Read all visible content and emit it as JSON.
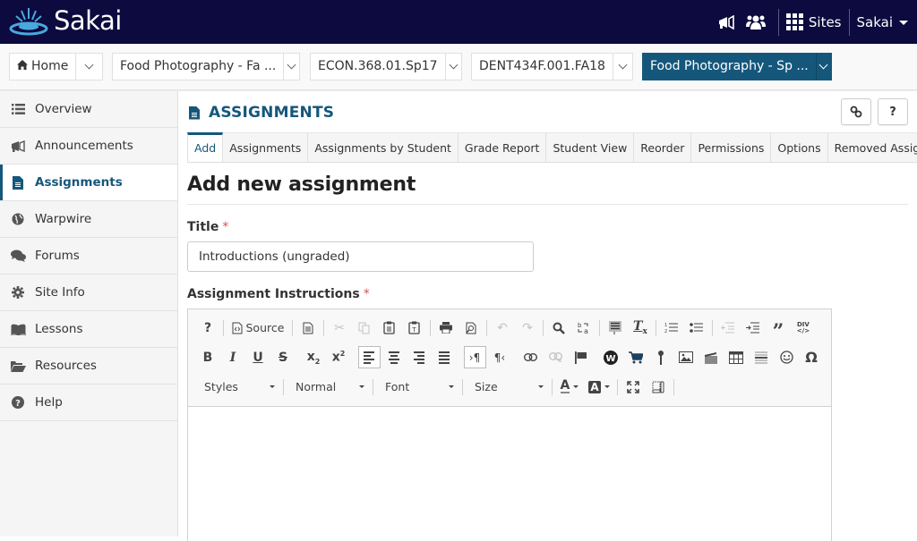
{
  "header": {
    "logo_text": "Sakai",
    "sites_label": "Sites",
    "user_label": "Sakai",
    "icons": [
      "megaphone-icon",
      "users-icon",
      "grid-icon"
    ]
  },
  "site_nav": {
    "tabs": [
      {
        "label": "Home",
        "icon": "home-icon",
        "active": false
      },
      {
        "label": "Food Photography - Fa ...",
        "active": false
      },
      {
        "label": "ECON.368.01.Sp17",
        "active": false
      },
      {
        "label": "DENT434F.001.FA18",
        "active": false
      },
      {
        "label": "Food Photography - Sp ...",
        "active": true
      }
    ]
  },
  "sidebar": {
    "items": [
      {
        "label": "Overview",
        "icon": "list-icon"
      },
      {
        "label": "Announcements",
        "icon": "megaphone-icon"
      },
      {
        "label": "Assignments",
        "icon": "document-icon",
        "active": true
      },
      {
        "label": "Warpwire",
        "icon": "globe-icon"
      },
      {
        "label": "Forums",
        "icon": "comments-icon"
      },
      {
        "label": "Site Info",
        "icon": "gear-icon"
      },
      {
        "label": "Lessons",
        "icon": "book-icon"
      },
      {
        "label": "Resources",
        "icon": "folder-open-icon"
      },
      {
        "label": "Help",
        "icon": "question-circle-icon"
      }
    ]
  },
  "tool": {
    "title": "ASSIGNMENTS",
    "link_button": "link-icon",
    "help_button": "?",
    "tabs": [
      {
        "label": "Add",
        "active": true
      },
      {
        "label": "Assignments"
      },
      {
        "label": "Assignments by Student"
      },
      {
        "label": "Grade Report"
      },
      {
        "label": "Student View"
      },
      {
        "label": "Reorder"
      },
      {
        "label": "Permissions"
      },
      {
        "label": "Options"
      },
      {
        "label": "Removed Assignments"
      }
    ]
  },
  "form": {
    "heading": "Add new assignment",
    "title_label": "Title",
    "title_value": "Introductions (ungraded)",
    "instructions_label": "Assignment Instructions",
    "required_mark": "*"
  },
  "editor": {
    "source_label": "Source",
    "styles_label": "Styles",
    "format_label": "Normal",
    "font_label": "Font",
    "size_label": "Size",
    "help_glyph": "?",
    "bold_glyph": "B",
    "italic_glyph": "I",
    "underline_glyph": "U",
    "strike_glyph": "S",
    "special_char_glyph": "Ω"
  }
}
